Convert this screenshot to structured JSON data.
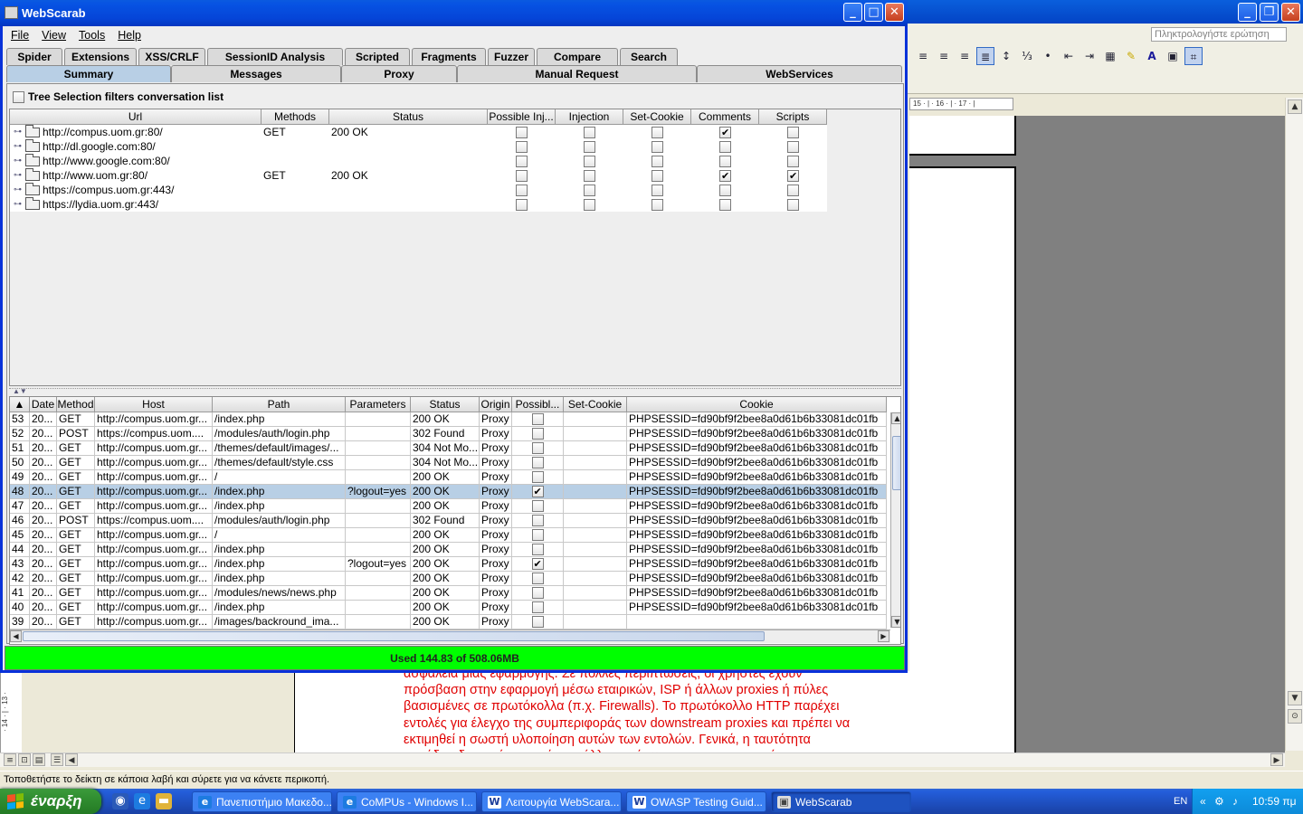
{
  "webscarab": {
    "title": "WebScarab",
    "menu": [
      "File",
      "View",
      "Tools",
      "Help"
    ],
    "tabs_row1": [
      "Spider",
      "Extensions",
      "XSS/CRLF",
      "SessionID Analysis",
      "Scripted",
      "Fragments",
      "Fuzzer",
      "Compare",
      "Search"
    ],
    "tabs_row2": [
      "Summary",
      "Messages",
      "Proxy",
      "Manual Request",
      "WebServices"
    ],
    "selected_tab": "Summary",
    "tree_selection_label": "Tree Selection filters conversation list",
    "tree_columns": [
      "Url",
      "Methods",
      "Status",
      "Possible Inj...",
      "Injection",
      "Set-Cookie",
      "Comments",
      "Scripts"
    ],
    "tree_rows": [
      {
        "url": "http://compus.uom.gr:80/",
        "methods": "GET",
        "status": "200 OK",
        "possible_inj": false,
        "injection": false,
        "set_cookie": false,
        "comments": true,
        "scripts": false
      },
      {
        "url": "http://dl.google.com:80/",
        "methods": "",
        "status": "",
        "possible_inj": false,
        "injection": false,
        "set_cookie": false,
        "comments": false,
        "scripts": false
      },
      {
        "url": "http://www.google.com:80/",
        "methods": "",
        "status": "",
        "possible_inj": false,
        "injection": false,
        "set_cookie": false,
        "comments": false,
        "scripts": false
      },
      {
        "url": "http://www.uom.gr:80/",
        "methods": "GET",
        "status": "200 OK",
        "possible_inj": false,
        "injection": false,
        "set_cookie": false,
        "comments": true,
        "scripts": true
      },
      {
        "url": "https://compus.uom.gr:443/",
        "methods": "",
        "status": "",
        "possible_inj": false,
        "injection": false,
        "set_cookie": false,
        "comments": false,
        "scripts": false
      },
      {
        "url": "https://lydia.uom.gr:443/",
        "methods": "",
        "status": "",
        "possible_inj": false,
        "injection": false,
        "set_cookie": false,
        "comments": false,
        "scripts": false
      }
    ],
    "conv_columns": [
      "",
      "Date",
      "Method",
      "Host",
      "Path",
      "Parameters",
      "Status",
      "Origin",
      "Possibl...",
      "Set-Cookie",
      "Cookie"
    ],
    "conv_rows": [
      {
        "id": "53",
        "date": "20...",
        "method": "GET",
        "host": "http://compus.uom.gr...",
        "path": "/index.php",
        "params": "",
        "status": "200 OK",
        "origin": "Proxy",
        "possible": false,
        "set_cookie": "",
        "cookie": "PHPSESSID=fd90bf9f2bee8a0d61b6b33081dc01fb"
      },
      {
        "id": "52",
        "date": "20...",
        "method": "POST",
        "host": "https://compus.uom....",
        "path": "/modules/auth/login.php",
        "params": "",
        "status": "302 Found",
        "origin": "Proxy",
        "possible": false,
        "set_cookie": "",
        "cookie": "PHPSESSID=fd90bf9f2bee8a0d61b6b33081dc01fb"
      },
      {
        "id": "51",
        "date": "20...",
        "method": "GET",
        "host": "http://compus.uom.gr...",
        "path": "/themes/default/images/...",
        "params": "",
        "status": "304 Not Mo...",
        "origin": "Proxy",
        "possible": false,
        "set_cookie": "",
        "cookie": "PHPSESSID=fd90bf9f2bee8a0d61b6b33081dc01fb"
      },
      {
        "id": "50",
        "date": "20...",
        "method": "GET",
        "host": "http://compus.uom.gr...",
        "path": "/themes/default/style.css",
        "params": "",
        "status": "304 Not Mo...",
        "origin": "Proxy",
        "possible": false,
        "set_cookie": "",
        "cookie": "PHPSESSID=fd90bf9f2bee8a0d61b6b33081dc01fb"
      },
      {
        "id": "49",
        "date": "20...",
        "method": "GET",
        "host": "http://compus.uom.gr...",
        "path": "/",
        "params": "",
        "status": "200 OK",
        "origin": "Proxy",
        "possible": false,
        "set_cookie": "",
        "cookie": "PHPSESSID=fd90bf9f2bee8a0d61b6b33081dc01fb"
      },
      {
        "id": "48",
        "date": "20...",
        "method": "GET",
        "host": "http://compus.uom.gr...",
        "path": "/index.php",
        "params": "?logout=yes",
        "status": "200 OK",
        "origin": "Proxy",
        "possible": true,
        "set_cookie": "",
        "cookie": "PHPSESSID=fd90bf9f2bee8a0d61b6b33081dc01fb",
        "selected": true
      },
      {
        "id": "47",
        "date": "20...",
        "method": "GET",
        "host": "http://compus.uom.gr...",
        "path": "/index.php",
        "params": "",
        "status": "200 OK",
        "origin": "Proxy",
        "possible": false,
        "set_cookie": "",
        "cookie": "PHPSESSID=fd90bf9f2bee8a0d61b6b33081dc01fb"
      },
      {
        "id": "46",
        "date": "20...",
        "method": "POST",
        "host": "https://compus.uom....",
        "path": "/modules/auth/login.php",
        "params": "",
        "status": "302 Found",
        "origin": "Proxy",
        "possible": false,
        "set_cookie": "",
        "cookie": "PHPSESSID=fd90bf9f2bee8a0d61b6b33081dc01fb"
      },
      {
        "id": "45",
        "date": "20...",
        "method": "GET",
        "host": "http://compus.uom.gr...",
        "path": "/",
        "params": "",
        "status": "200 OK",
        "origin": "Proxy",
        "possible": false,
        "set_cookie": "",
        "cookie": "PHPSESSID=fd90bf9f2bee8a0d61b6b33081dc01fb"
      },
      {
        "id": "44",
        "date": "20...",
        "method": "GET",
        "host": "http://compus.uom.gr...",
        "path": "/index.php",
        "params": "",
        "status": "200 OK",
        "origin": "Proxy",
        "possible": false,
        "set_cookie": "",
        "cookie": "PHPSESSID=fd90bf9f2bee8a0d61b6b33081dc01fb"
      },
      {
        "id": "43",
        "date": "20...",
        "method": "GET",
        "host": "http://compus.uom.gr...",
        "path": "/index.php",
        "params": "?logout=yes",
        "status": "200 OK",
        "origin": "Proxy",
        "possible": true,
        "set_cookie": "",
        "cookie": "PHPSESSID=fd90bf9f2bee8a0d61b6b33081dc01fb"
      },
      {
        "id": "42",
        "date": "20...",
        "method": "GET",
        "host": "http://compus.uom.gr...",
        "path": "/index.php",
        "params": "",
        "status": "200 OK",
        "origin": "Proxy",
        "possible": false,
        "set_cookie": "",
        "cookie": "PHPSESSID=fd90bf9f2bee8a0d61b6b33081dc01fb"
      },
      {
        "id": "41",
        "date": "20...",
        "method": "GET",
        "host": "http://compus.uom.gr...",
        "path": "/modules/news/news.php",
        "params": "",
        "status": "200 OK",
        "origin": "Proxy",
        "possible": false,
        "set_cookie": "",
        "cookie": "PHPSESSID=fd90bf9f2bee8a0d61b6b33081dc01fb"
      },
      {
        "id": "40",
        "date": "20...",
        "method": "GET",
        "host": "http://compus.uom.gr...",
        "path": "/index.php",
        "params": "",
        "status": "200 OK",
        "origin": "Proxy",
        "possible": false,
        "set_cookie": "",
        "cookie": "PHPSESSID=fd90bf9f2bee8a0d61b6b33081dc01fb"
      },
      {
        "id": "39",
        "date": "20...",
        "method": "GET",
        "host": "http://compus.uom.gr...",
        "path": "/images/backround_ima...",
        "params": "",
        "status": "200 OK",
        "origin": "Proxy",
        "possible": false,
        "set_cookie": "",
        "cookie": ""
      }
    ],
    "memory_status": "Used 144.83 of 508.06MB",
    "memory_bar_color": "#00ff00"
  },
  "word": {
    "ask_placeholder": "Πληκτρολογήστε ερώτηση",
    "ruler_text": "15 · | · 16 · | · 17 · |",
    "left_ruler_text": "· 14 · | · 13 ·",
    "greek_lines": [
      "ασφάλεια μιας εφαρμογής. Σε πολλές περιπτώσεις, οι χρήστες έχουν",
      "πρόσβαση στην εφαρμογή μέσω εταιρικών, ISP ή άλλων proxies ή πύλες",
      "βασισμένες σε πρωτόκολλα (π.χ. Firewalls). Το πρωτόκολλο HTTP παρέχει",
      "εντολές για έλεγχο της συμπεριφοράς των downstream proxies και πρέπει να",
      "εκτιμηθεί η σωστή υλοποίηση αυτών των εντολών. Γενικά, η ταυτότητα",
      "συνόδου δεν πρέπει ποτέ να πάλλεται μέσω μη κρυπτογραφημένου"
    ],
    "text_color": "#e00000",
    "status_text": "Τοποθετήστε το δείκτη σε κάποια λαβή και σύρετε για να κάνετε περικοπή."
  },
  "taskbar": {
    "start_label": "έναρξη",
    "tasks": [
      {
        "label": "Πανεπιστήμιο Μακεδο...",
        "icon": "ie-icon",
        "glyph": "e"
      },
      {
        "label": "CoMPUs - Windows I...",
        "icon": "ie-icon",
        "glyph": "e"
      },
      {
        "label": "Λειτουργία WebScara...",
        "icon": "word-icon",
        "glyph": "W"
      },
      {
        "label": "OWASP Testing Guid...",
        "icon": "word-icon",
        "glyph": "W"
      },
      {
        "label": "WebScarab",
        "icon": "java-icon",
        "glyph": "▣"
      }
    ],
    "active_task": "WebScarab",
    "language": "EN",
    "clock": "10:59 πμ"
  }
}
